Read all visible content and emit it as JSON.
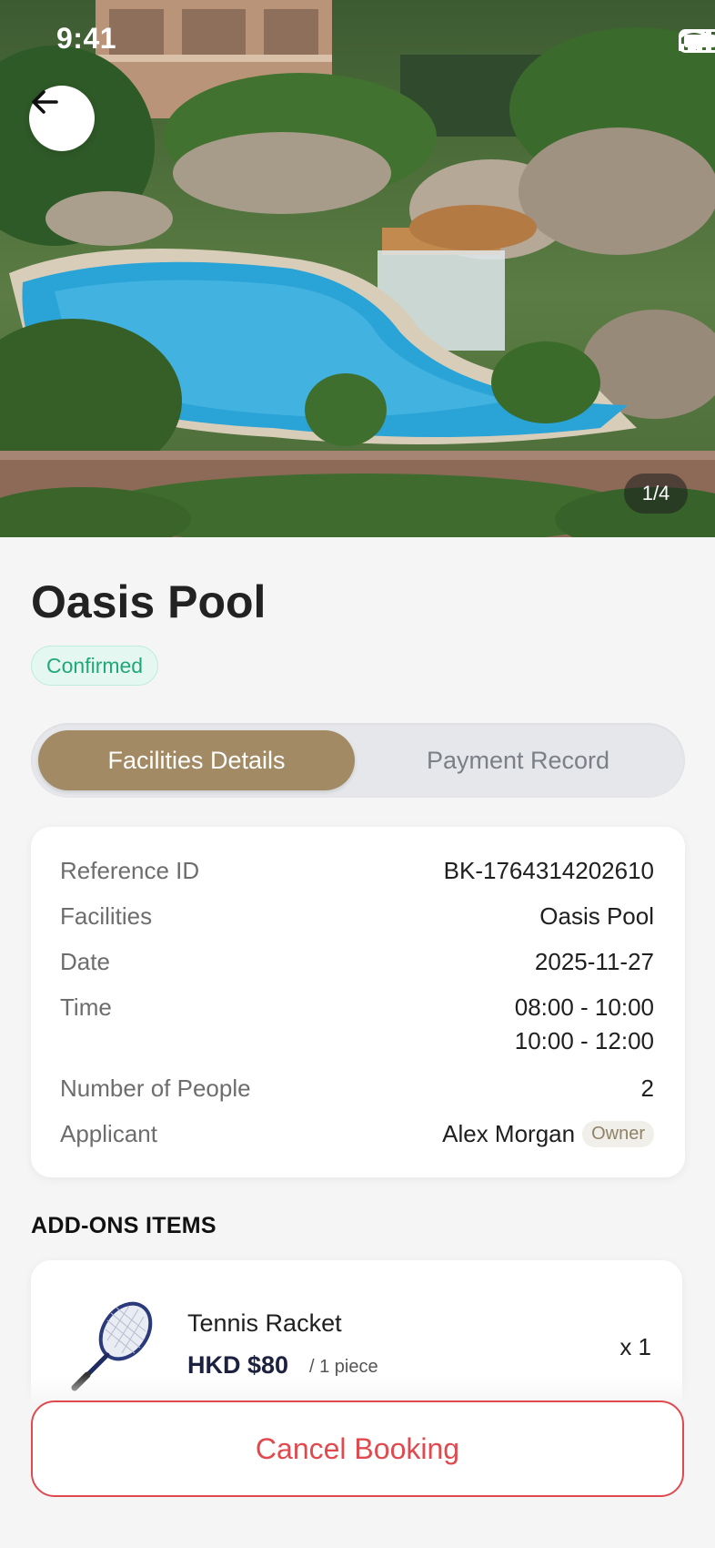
{
  "status_bar": {
    "time": "9:41"
  },
  "hero": {
    "pager": "1/4"
  },
  "facility": {
    "name": "Oasis Pool",
    "status": "Confirmed"
  },
  "tabs": [
    {
      "label": "Facilities Details",
      "active": true
    },
    {
      "label": "Payment Record",
      "active": false
    }
  ],
  "details": {
    "reference_id": {
      "label": "Reference ID",
      "value": "BK-1764314202610"
    },
    "facilities": {
      "label": "Facilities",
      "value": "Oasis Pool"
    },
    "date": {
      "label": "Date",
      "value": "2025-11-27"
    },
    "time": {
      "label": "Time",
      "slots": [
        "08:00 - 10:00",
        "10:00 - 12:00"
      ]
    },
    "people": {
      "label": "Number of People",
      "value": "2"
    },
    "applicant": {
      "label": "Applicant",
      "value": "Alex Morgan",
      "role": "Owner"
    }
  },
  "addons": {
    "title": "ADD-ONS ITEMS",
    "items": [
      {
        "name": "Tennis Racket",
        "price": "HKD $80",
        "unit": "/ 1 piece",
        "quantity": "x 1"
      }
    ]
  },
  "actions": {
    "cancel_label": "Cancel Booking"
  },
  "colors": {
    "accent": "#a28b64",
    "confirmed": "#20a878",
    "danger": "#e04a4f",
    "price": "#1c2140"
  }
}
